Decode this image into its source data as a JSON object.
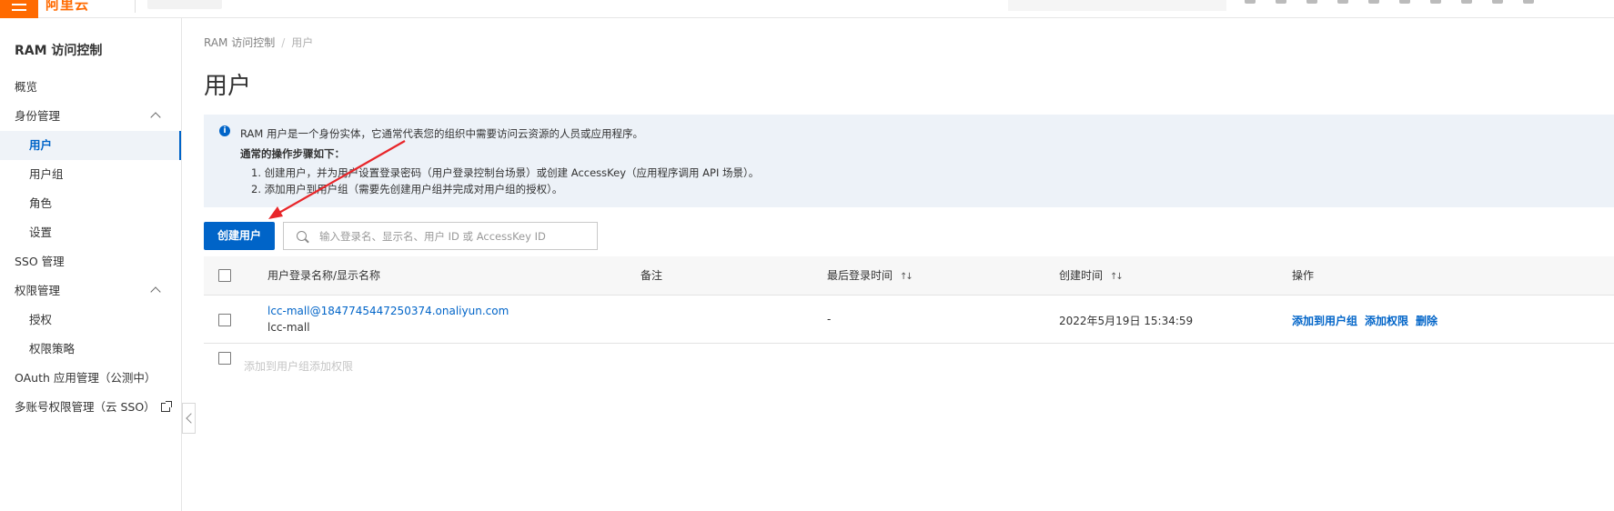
{
  "topbar": {
    "brand": "阿里云"
  },
  "sidebar": {
    "title": "RAM 访问控制",
    "items": [
      {
        "label": "概览"
      },
      {
        "label": "身份管理"
      },
      {
        "label": "用户"
      },
      {
        "label": "用户组"
      },
      {
        "label": "角色"
      },
      {
        "label": "设置"
      },
      {
        "label": "SSO 管理"
      },
      {
        "label": "权限管理"
      },
      {
        "label": "授权"
      },
      {
        "label": "权限策略"
      },
      {
        "label": "OAuth 应用管理（公测中）"
      },
      {
        "label": "多账号权限管理（云 SSO）"
      }
    ]
  },
  "breadcrumb": {
    "root": "RAM 访问控制",
    "sep": "/",
    "current": "用户"
  },
  "page": {
    "title": "用户"
  },
  "info": {
    "icon": "info-icon",
    "line1": "RAM 用户是一个身份实体，它通常代表您的组织中需要访问云资源的人员或应用程序。",
    "line2": "通常的操作步骤如下：",
    "step1": "1. 创建用户，并为用户设置登录密码（用户登录控制台场景）或创建 AccessKey（应用程序调用 API 场景）。",
    "step2": "2. 添加用户到用户组（需要先创建用户组并完成对用户组的授权）。"
  },
  "toolbar": {
    "create_label": "创建用户",
    "search_placeholder": "输入登录名、显示名、用户 ID 或 AccessKey ID"
  },
  "table": {
    "headers": {
      "name": "用户登录名称/显示名称",
      "note": "备注",
      "last_login": "最后登录时间",
      "created": "创建时间",
      "ops": "操作"
    },
    "sort_glyph": "↑↓",
    "rows": [
      {
        "login": "lcc-mall@1847745447250374.onaliyun.com",
        "display": "lcc-mall",
        "note": "",
        "last_login": "-",
        "created": "2022年5月19日 15:34:59",
        "ops": [
          "添加到用户组",
          "添加权限",
          "删除"
        ]
      }
    ]
  },
  "batch": {
    "add_group": "添加到用户组",
    "add_perm": "添加权限"
  },
  "colors": {
    "accent": "#0064c8",
    "brand": "#ff6a00",
    "annotation": "#e8262a"
  }
}
